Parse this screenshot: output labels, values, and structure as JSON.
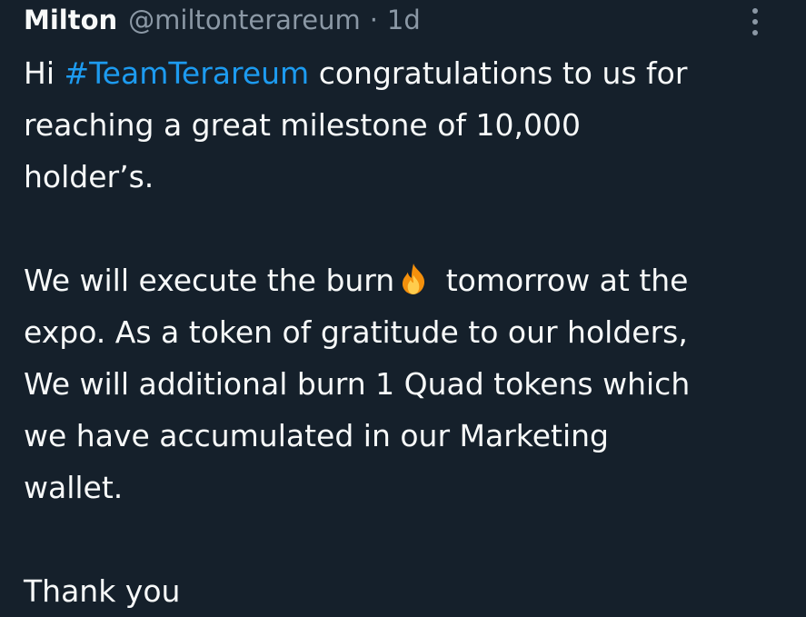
{
  "author": {
    "name": "Milton",
    "handle": "@miltonterareum",
    "separator": "·",
    "time": "1d"
  },
  "more_menu": {
    "icon": "vertical-dots-icon"
  },
  "tweet": {
    "p1_l1_pre": "Hi ",
    "hashtag": "#TeamTerareum",
    "p1_l1_post": " congratulations to us for",
    "p1_l2": "reaching a great milestone of 10,000",
    "p1_l3": "holder’s.",
    "p2_l1_pre": "We will execute the burn",
    "emoji": "fire-emoji",
    "p2_l1_post": " tomorrow at the",
    "p2_l2": "expo. As a token of gratitude to our holders,",
    "p2_l3": "We will additional burn 1 Quad tokens which",
    "p2_l4": "we have accumulated in our Marketing",
    "p2_l5": "wallet.",
    "p3_l1": "Thank you"
  },
  "colors": {
    "background": "#15202b",
    "text": "#f7f9f9",
    "secondary": "#8b98a5",
    "link": "#1d9bf0"
  }
}
